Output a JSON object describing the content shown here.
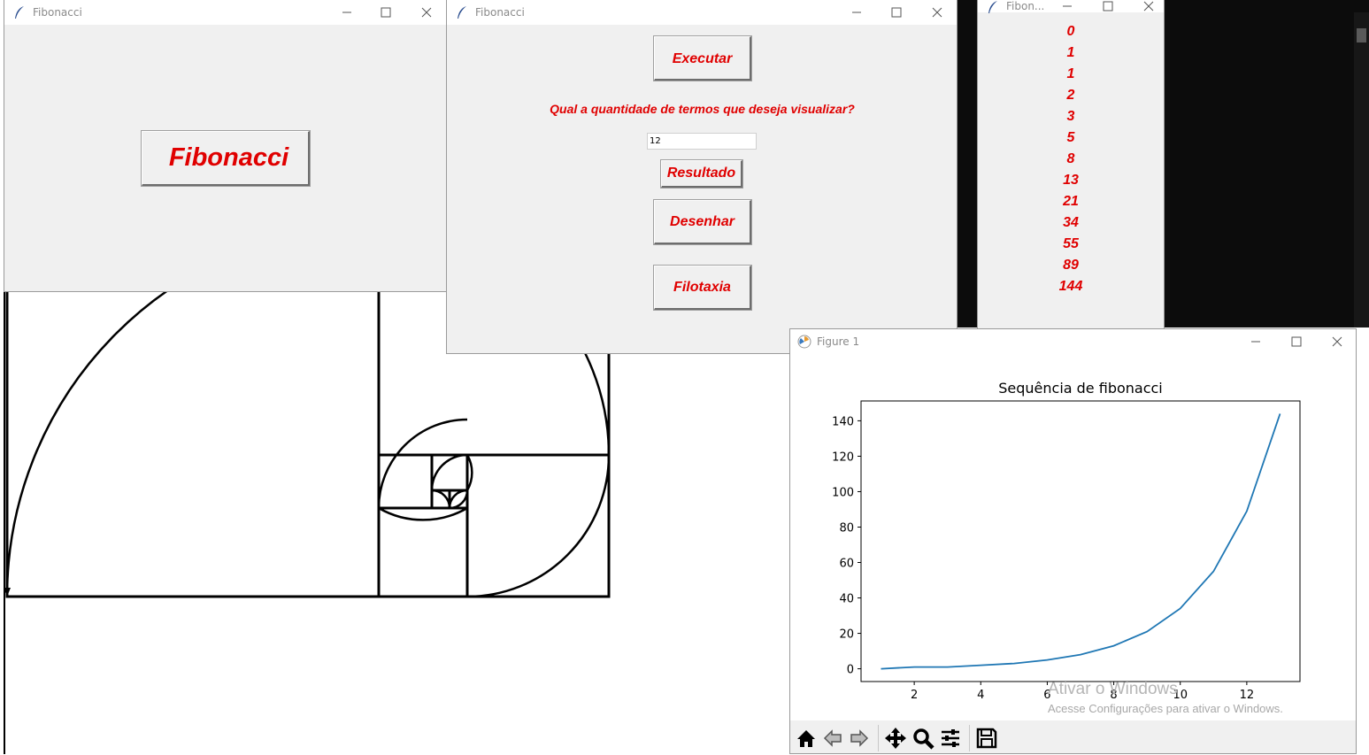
{
  "window1": {
    "title": "Fibonacci",
    "button_label": "Fibonacci"
  },
  "window2": {
    "title": "Fibonacci",
    "execute_label": "Executar",
    "question": "Qual a quantidade de termos que deseja visualizar?",
    "input_value": "12",
    "result_label": "Resultado",
    "draw_label": "Desenhar",
    "phyllotaxis_label": "Filotaxia"
  },
  "window3": {
    "title": "Fibon...",
    "numbers": [
      "0",
      "1",
      "1",
      "2",
      "3",
      "5",
      "8",
      "13",
      "21",
      "34",
      "55",
      "89",
      "144"
    ]
  },
  "figure": {
    "title": "Figure 1",
    "toolbar": [
      "home-icon",
      "back-icon",
      "forward-icon",
      "pan-icon",
      "zoom-icon",
      "configure-subplots-icon",
      "save-icon"
    ]
  },
  "chart_data": {
    "type": "line",
    "title": "Sequência de fibonacci",
    "xlabel": "",
    "ylabel": "",
    "xlim": [
      0.4,
      13.6
    ],
    "ylim": [
      -7.2,
      151.2
    ],
    "xticks": [
      2,
      4,
      6,
      8,
      10,
      12
    ],
    "yticks": [
      0,
      20,
      40,
      60,
      80,
      100,
      120,
      140
    ],
    "series": [
      {
        "x": [
          1,
          2,
          3,
          4,
          5,
          6,
          7,
          8,
          9,
          10,
          11,
          12,
          13
        ],
        "y": [
          0,
          1,
          1,
          2,
          3,
          5,
          8,
          13,
          21,
          34,
          55,
          89,
          144
        ],
        "color": "#1f77b4"
      }
    ],
    "grid": false
  },
  "watermark": {
    "line1": "Ativar o Windows",
    "line2": "Acesse Configurações para ativar o Windows."
  },
  "colors": {
    "accent": "#e00000",
    "line": "#1f77b4",
    "terminal": "#0c0c0c"
  }
}
